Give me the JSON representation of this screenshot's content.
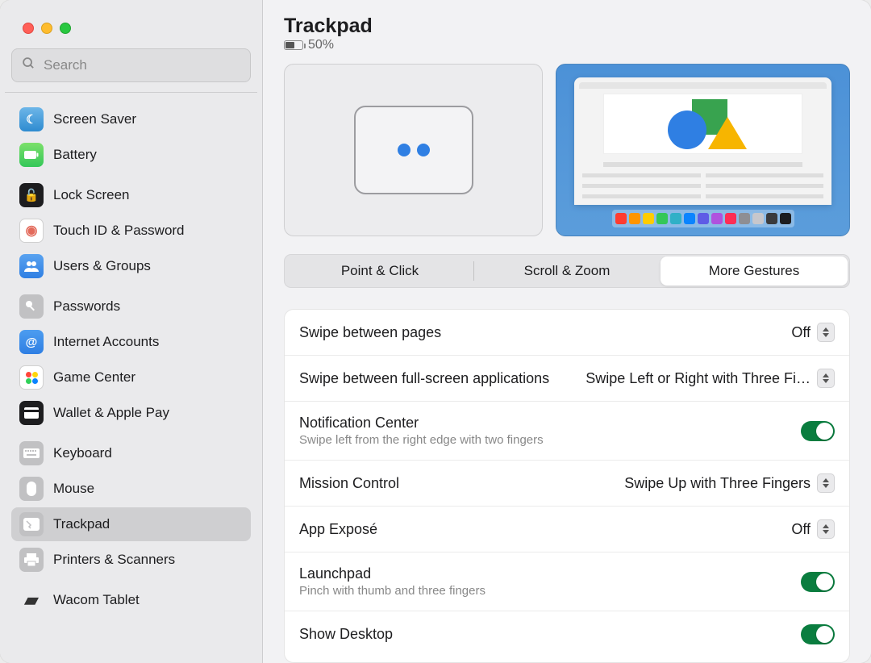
{
  "window": {
    "title": "Trackpad",
    "battery_level": "50%"
  },
  "search": {
    "placeholder": "Search"
  },
  "sidebar": {
    "items": [
      {
        "label": "Screen Saver"
      },
      {
        "label": "Battery"
      },
      {
        "label": "Lock Screen"
      },
      {
        "label": "Touch ID & Password"
      },
      {
        "label": "Users & Groups"
      },
      {
        "label": "Passwords"
      },
      {
        "label": "Internet Accounts"
      },
      {
        "label": "Game Center"
      },
      {
        "label": "Wallet & Apple Pay"
      },
      {
        "label": "Keyboard"
      },
      {
        "label": "Mouse"
      },
      {
        "label": "Trackpad"
      },
      {
        "label": "Printers & Scanners"
      },
      {
        "label": "Wacom Tablet"
      }
    ]
  },
  "tabs": {
    "point_click": "Point & Click",
    "scroll_zoom": "Scroll & Zoom",
    "more_gestures": "More Gestures"
  },
  "settings": {
    "swipe_pages": {
      "label": "Swipe between pages",
      "value": "Off"
    },
    "swipe_apps": {
      "label": "Swipe between full-screen applications",
      "value": "Swipe Left or Right with Three Fi…"
    },
    "notification_center": {
      "label": "Notification Center",
      "desc": "Swipe left from the right edge with two fingers",
      "value": true
    },
    "mission_control": {
      "label": "Mission Control",
      "value": "Swipe Up with Three Fingers"
    },
    "app_expose": {
      "label": "App Exposé",
      "value": "Off"
    },
    "launchpad": {
      "label": "Launchpad",
      "desc": "Pinch with thumb and three fingers",
      "value": true
    },
    "show_desktop": {
      "label": "Show Desktop",
      "value": true
    }
  },
  "dock_colors": [
    "#ff3b30",
    "#ff9500",
    "#ffcc00",
    "#34c759",
    "#30b0c7",
    "#0a84ff",
    "#5e5ce6",
    "#af52de",
    "#ff2d55",
    "#8e8e93",
    "#c7c7cc",
    "#3a3a3c",
    "#1d1d1f"
  ]
}
